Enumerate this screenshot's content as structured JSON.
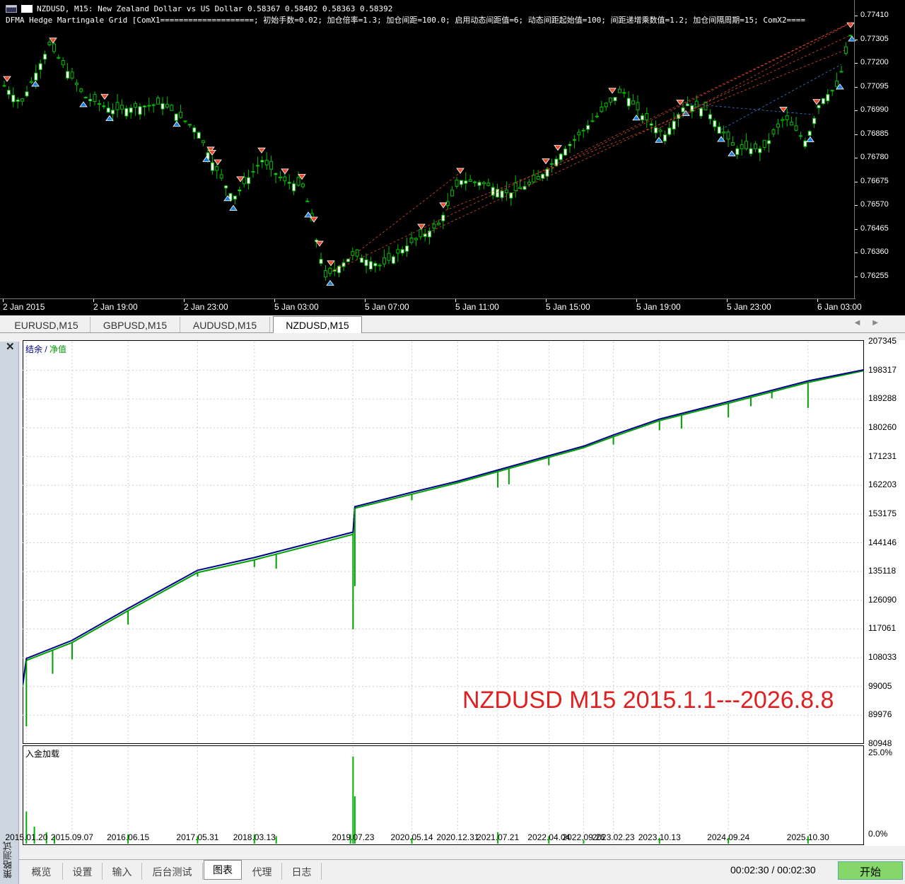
{
  "chart_window": {
    "title_line": "NZDUSD, M15:  New Zealand Dollar vs US Dollar  0.58367 0.58402 0.58363 0.58392",
    "indicator_line": "DFMA Hedge Martingale Grid [ComX1====================; 初始手数=0.02; 加仓倍率=1.3; 加仓间距=100.0; 启用动态间距值=6; 动态间距起始值=100; 间距递增乘数值=1.2; 加仓间隔周期=15; ComX2====",
    "price_ticks": [
      "0.77410",
      "0.77305",
      "0.77200",
      "0.77095",
      "0.76990",
      "0.76885",
      "0.76780",
      "0.76675",
      "0.76570",
      "0.76465",
      "0.76360",
      "0.76255"
    ],
    "time_ticks": [
      "2 Jan 2015",
      "2 Jan 19:00",
      "2 Jan 23:00",
      "5 Jan 03:00",
      "5 Jan 07:00",
      "5 Jan 11:00",
      "5 Jan 15:00",
      "5 Jan 19:00",
      "5 Jan 23:00",
      "6 Jan 03:00"
    ],
    "colors": {
      "background": "#000000",
      "bull": "#ffffff",
      "bear": "#000000",
      "wick": "#00c000",
      "buy_arrow": "#1e7fd8",
      "sell_arrow": "#e84b2c"
    }
  },
  "symbol_tabs": [
    {
      "label": "EURUSD,M15",
      "active": false
    },
    {
      "label": "GBPUSD,M15",
      "active": false
    },
    {
      "label": "AUDUSD,M15",
      "active": false
    },
    {
      "label": "NZDUSD,M15",
      "active": true
    }
  ],
  "tab_arrows": "◀▶",
  "tester": {
    "close_glyph": "✕",
    "side_label": "策略测试",
    "legend_balance": "结余",
    "legend_sep": " / ",
    "legend_equity": "净值",
    "watermark": "NZDUSD M15 2015.1.1---2026.8.8",
    "load_label": "入金加载",
    "load_ticks": [
      "25.0%",
      "0.0%"
    ],
    "colors": {
      "balance": "#00008b",
      "equity": "#00a000",
      "load": "#00b000",
      "grid": "#d0d0d0",
      "watermark": "#e02020"
    }
  },
  "chart_data": [
    {
      "type": "line",
      "title": "",
      "series": [
        {
          "name": "结余",
          "x": [
            "2015.01.01",
            "2015.01.20",
            "2015.09.07",
            "2016.06.15",
            "2017.05.31",
            "2018.03.13",
            "2019.07.23",
            "2019.08.01",
            "2020.05.14",
            "2020.12.31",
            "2021.07.21",
            "2022.04.04",
            "2022.09.26",
            "2023.02.23",
            "2023.10.13",
            "2024.09.24",
            "2025.10.30",
            "2026.08.08"
          ],
          "values": [
            99500,
            107800,
            113500,
            123500,
            135500,
            139500,
            147500,
            155500,
            160000,
            163500,
            167000,
            171500,
            174500,
            178000,
            183000,
            188500,
            195000,
            198500
          ]
        },
        {
          "name": "净值",
          "x": [
            "2015.01.01",
            "2015.01.20",
            "2015.09.07",
            "2016.06.15",
            "2017.05.31",
            "2018.03.13",
            "2019.07.23",
            "2019.08.01",
            "2020.05.14",
            "2020.12.31",
            "2021.07.21",
            "2022.04.04",
            "2022.09.26",
            "2023.02.23",
            "2023.10.13",
            "2024.09.24",
            "2025.10.30",
            "2026.08.08"
          ],
          "values": [
            99000,
            107200,
            112800,
            122800,
            134800,
            138800,
            146800,
            155000,
            159400,
            163000,
            166500,
            171000,
            174000,
            177500,
            182500,
            188000,
            194500,
            198200
          ]
        }
      ],
      "equity_dips": [
        {
          "x": "2015.01.20",
          "value": 86500
        },
        {
          "x": "2015.06.01",
          "value": 103000
        },
        {
          "x": "2015.09.07",
          "value": 107500
        },
        {
          "x": "2016.06.15",
          "value": 118500
        },
        {
          "x": "2017.05.31",
          "value": 133500
        },
        {
          "x": "2018.03.13",
          "value": 136500
        },
        {
          "x": "2018.07.01",
          "value": 136000
        },
        {
          "x": "2019.07.23",
          "value": 117000
        },
        {
          "x": "2019.08.01",
          "value": 130500
        },
        {
          "x": "2020.05.14",
          "value": 157500
        },
        {
          "x": "2021.07.21",
          "value": 161500
        },
        {
          "x": "2021.09.15",
          "value": 162500
        },
        {
          "x": "2022.04.04",
          "value": 168500
        },
        {
          "x": "2023.02.23",
          "value": 175000
        },
        {
          "x": "2023.10.13",
          "value": 179500
        },
        {
          "x": "2024.02.01",
          "value": 180000
        },
        {
          "x": "2024.09.24",
          "value": 183500
        },
        {
          "x": "2025.01.15",
          "value": 187000
        },
        {
          "x": "2025.05.01",
          "value": 189500
        },
        {
          "x": "2025.10.30",
          "value": 186500
        }
      ],
      "y_ticks": [
        "207345",
        "198317",
        "189288",
        "180260",
        "171231",
        "162203",
        "153175",
        "144146",
        "135118",
        "126090",
        "117061",
        "108033",
        "99005",
        "89976",
        "80948"
      ],
      "ylim": [
        80948,
        207345
      ],
      "x_ticks": [
        "2015.01.20",
        "2015.09.07",
        "2016.06.15",
        "2017.05.31",
        "2018.03.13",
        "2019.07.23",
        "2020.05.14",
        "2020.12.31",
        "2021.07.21",
        "2022.04.04",
        "2022.09.26",
        "2023.02.23",
        "2023.10.13",
        "2024.09.24",
        "2025.10.30"
      ],
      "grid": true
    },
    {
      "type": "bar",
      "title": "入金加载",
      "ylim": [
        0,
        25
      ],
      "x": [
        "2015.01.20",
        "2015.03.01",
        "2015.05.01",
        "2015.06.10",
        "2016.06.15",
        "2017.05.31",
        "2018.03.13",
        "2018.07.01",
        "2019.07.10",
        "2019.07.23",
        "2019.08.01",
        "2020.05.14",
        "2021.07.21",
        "2022.04.04",
        "2022.09.26",
        "2023.10.13",
        "2024.09.24",
        "2025.10.30"
      ],
      "values": [
        8.5,
        4.5,
        3.0,
        2.0,
        2.5,
        2.0,
        2.5,
        2.0,
        2.5,
        23.0,
        12.5,
        1.5,
        3.0,
        2.0,
        1.0,
        1.5,
        1.5,
        2.0
      ]
    }
  ],
  "bottom_tabs": [
    {
      "label": "概览",
      "active": false
    },
    {
      "label": "设置",
      "active": false
    },
    {
      "label": "输入",
      "active": false
    },
    {
      "label": "后台测试",
      "active": false
    },
    {
      "label": "图表",
      "active": true
    },
    {
      "label": "代理",
      "active": false
    },
    {
      "label": "日志",
      "active": false
    }
  ],
  "timer": "00:02:30 / 00:02:30",
  "start_label": "开始"
}
